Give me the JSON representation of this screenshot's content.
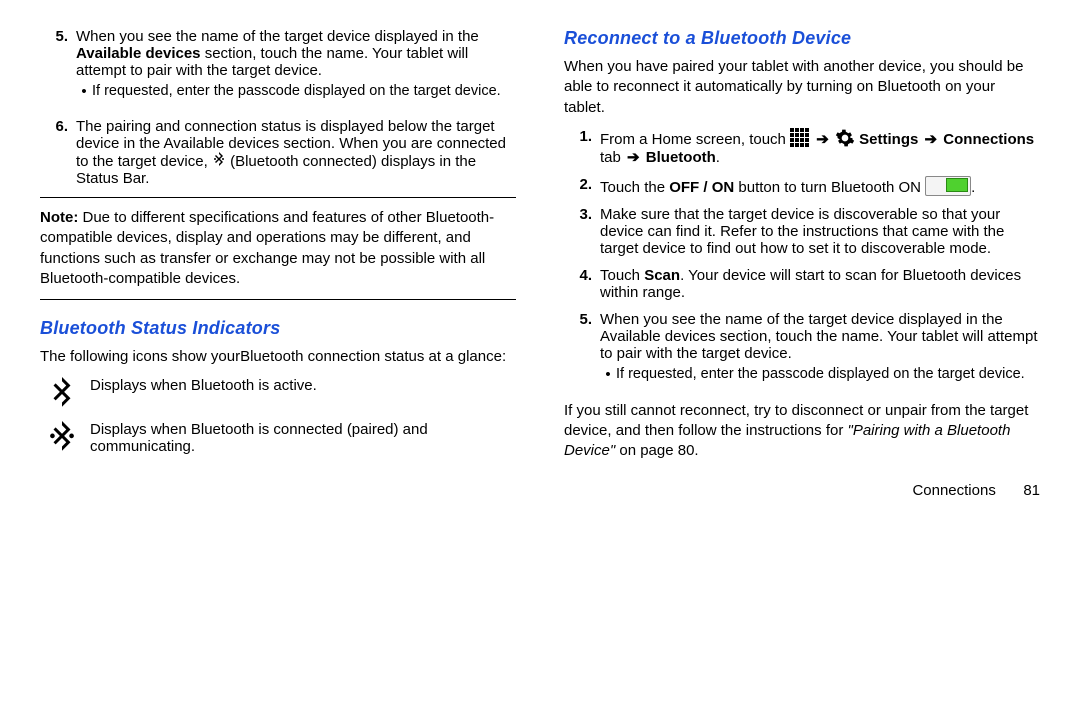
{
  "left": {
    "step5": {
      "num": "5.",
      "text_a": "When you see the name of the target device displayed in the ",
      "bold_a": "Available devices",
      "text_b": " section, touch the name. Your tablet will attempt to pair with the target device.",
      "bullet": "If requested, enter the passcode displayed on the target device."
    },
    "step6": {
      "num": "6.",
      "text_a": "The pairing and connection status is displayed below the target device in the Available devices section. When you are connected to the target device, ",
      "text_b": " (Bluetooth connected) displays in the Status Bar."
    },
    "note": {
      "label": "Note:",
      "text": " Due to different specifications and features of other Bluetooth-compatible devices, display and operations may be different, and functions such as transfer or exchange may not be possible with all Bluetooth-compatible devices."
    },
    "indicators": {
      "heading": "Bluetooth Status Indicators",
      "intro": "The following icons show yourBluetooth connection status at a glance:",
      "row1": "Displays when Bluetooth is active.",
      "row2": "Displays when Bluetooth is connected (paired) and communicating."
    }
  },
  "right": {
    "heading": "Reconnect to a Bluetooth Device",
    "intro": "When you have paired your tablet with another device, you should be able to reconnect it automatically by turning on Bluetooth on your tablet.",
    "step1": {
      "num": "1.",
      "text_a": "From a Home screen, touch ",
      "bold_settings": "Settings",
      "bold_conn": "Connections",
      "tab_word": " tab ",
      "bold_bt": "Bluetooth",
      "dot": "."
    },
    "step2": {
      "num": "2.",
      "text_a": "Touch the ",
      "bold_offon": "OFF / ON",
      "text_b": " button to turn Bluetooth ON ",
      "dot": "."
    },
    "step3": {
      "num": "3.",
      "text": "Make sure that the target device is discoverable so that your device can find it. Refer to the instructions that came with the target device to find out how to set it to discoverable mode."
    },
    "step4": {
      "num": "4.",
      "text_a": "Touch ",
      "bold_scan": "Scan",
      "text_b": ". Your device will start to scan for Bluetooth devices within range."
    },
    "step5": {
      "num": "5.",
      "text": "When you see the name of the target device displayed in the Available devices section, touch the name. Your tablet will attempt to pair with the target device.",
      "bullet": "If requested, enter the passcode displayed on the target device."
    },
    "outro_a": "If you still cannot reconnect, try to disconnect or unpair from the target device, and then follow the instructions for ",
    "outro_ref": "\"Pairing with a Bluetooth Device\"",
    "outro_b": " on page 80."
  },
  "footer": {
    "section": "Connections",
    "page": "81"
  },
  "glyphs": {
    "arrow": "➔",
    "bullet": "•"
  }
}
